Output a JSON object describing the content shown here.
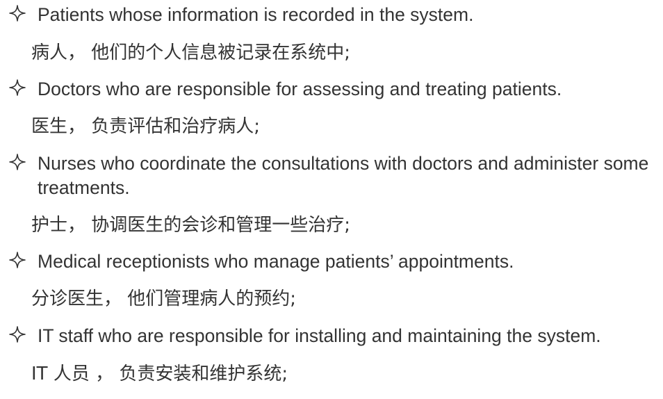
{
  "items": [
    {
      "en": "Patients whose information is recorded in the system.",
      "zh": "病人， 他们的个人信息被记录在系统中;"
    },
    {
      "en": "Doctors who are responsible for assessing and treating patients.",
      "zh": "医生， 负责评估和治疗病人;"
    },
    {
      "en": "Nurses who coordinate the consultations with doctors and administer some treatments.",
      "zh": "护士， 协调医生的会诊和管理一些治疗;"
    },
    {
      "en": "Medical receptionists who manage patients’ appointments.",
      "zh": "分诊医生， 他们管理病人的预约;"
    },
    {
      "en": "IT staff who are responsible for installing and maintaining the system.",
      "zh": "IT 人员 ， 负责安装和维护系统;"
    }
  ],
  "bullet_icon": "four-pointed-star-outline-icon",
  "text_color": "#333333"
}
